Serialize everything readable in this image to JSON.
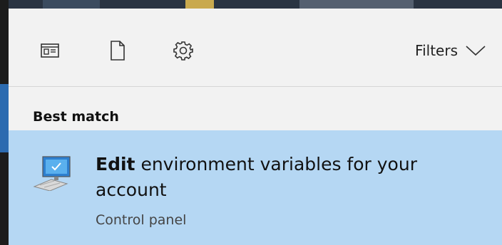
{
  "toolbar": {
    "filters_label": "Filters",
    "icons": [
      "apps-icon",
      "document-icon",
      "settings-icon",
      "chevron-down-icon"
    ]
  },
  "results": {
    "section_title": "Best match",
    "top_result": {
      "title_bold": "Edit",
      "title_rest": " environment variables for your account",
      "subtitle": "Control panel",
      "icon": "computer-monitor-icon"
    }
  },
  "colors": {
    "panel_bg": "#f2f2f2",
    "selected_bg": "#b5d7f3",
    "taskbar_accent": "#2c6bb0"
  }
}
